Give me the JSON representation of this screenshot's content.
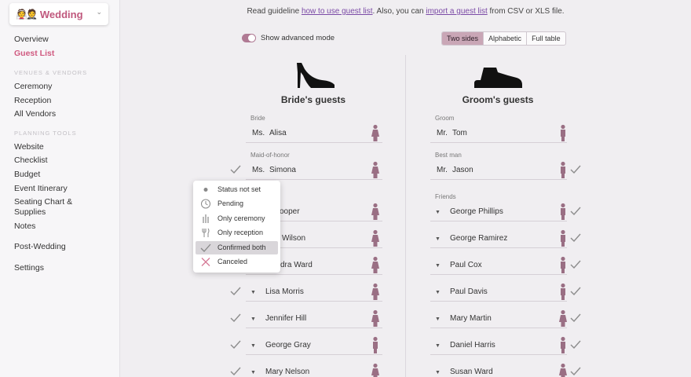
{
  "sidebar": {
    "brand": "Wedding",
    "items": [
      {
        "label": "Overview"
      },
      {
        "label": "Guest List"
      },
      {
        "label": "Ceremony"
      },
      {
        "label": "Reception"
      },
      {
        "label": "All Vendors"
      },
      {
        "label": "Website"
      },
      {
        "label": "Checklist"
      },
      {
        "label": "Budget"
      },
      {
        "label": "Event Itinerary"
      },
      {
        "label": "Seating Chart &"
      },
      {
        "label": "Supplies"
      },
      {
        "label": "Notes"
      },
      {
        "label": "Post-Wedding"
      },
      {
        "label": "Settings"
      }
    ],
    "section_venues": "VENUES & VENDORS",
    "section_tools": "PLANNING TOOLS"
  },
  "guideline": {
    "prefix": "Read guideline",
    "link1": "how to use guest list",
    "middle": ". Also, you can",
    "link2": "import a guest list",
    "suffix": "from CSV or XLS file."
  },
  "advanced_mode_label": "Show advanced mode",
  "views": [
    "Two sides",
    "Alphabetic",
    "Full table"
  ],
  "bride": {
    "title": "Bride's guests",
    "bride_label": "Bride",
    "bride_prefix": "Ms.",
    "bride_name": "Alisa",
    "moh_label": "Maid-of-honor",
    "moh_prefix": "Ms.",
    "moh_name": "Simona",
    "guests": [
      "y Cooper",
      "Wilson",
      "dra Ward",
      "Lisa Morris",
      "Jennifer Hill",
      "George Gray",
      "Mary Nelson"
    ]
  },
  "groom": {
    "title": "Groom's guests",
    "groom_label": "Groom",
    "groom_prefix": "Mr.",
    "groom_name": "Tom",
    "best_label": "Best man",
    "best_prefix": "Mr.",
    "best_name": "Jason",
    "friends_label": "Friends",
    "guests": [
      "George Phillips",
      "George Ramirez",
      "Paul Cox",
      "Paul Davis",
      "Mary Martin",
      "Daniel Harris",
      "Susan Ward"
    ]
  },
  "status_menu": [
    "Status not set",
    "Pending",
    "Only ceremony",
    "Only reception",
    "Confirmed both",
    "Canceled"
  ],
  "colors": {
    "accent": "#d05a80",
    "person": "#9a6f84",
    "check": "#8c8c8c"
  }
}
